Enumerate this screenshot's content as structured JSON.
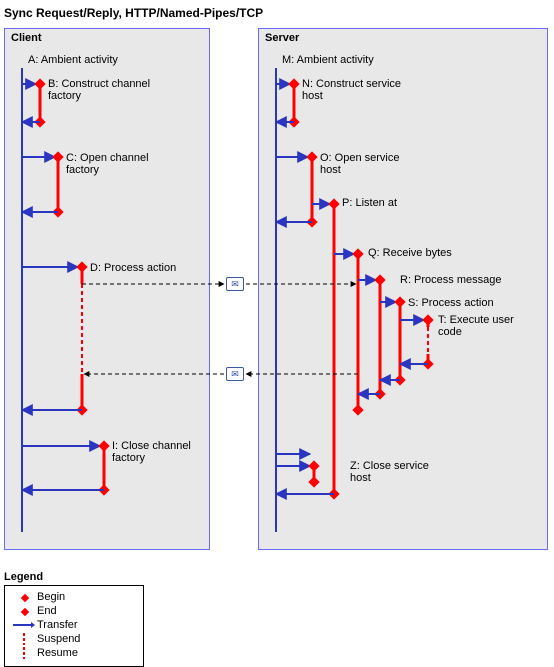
{
  "title": "Sync Request/Reply, HTTP/Named-Pipes/TCP",
  "client": {
    "title": "Client",
    "a": "A: Ambient activity",
    "b": "B: Construct channel factory",
    "c": "C: Open channel factory",
    "d": "D: Process action",
    "i": "I: Close channel factory"
  },
  "server": {
    "title": "Server",
    "m": "M: Ambient activity",
    "n": "N: Construct service host",
    "o": "O: Open service host",
    "p": "P: Listen at",
    "q": "Q: Receive bytes",
    "r": "R: Process message",
    "s": "S: Process action",
    "t": "T: Execute user code",
    "z": "Z: Close service host"
  },
  "legend": {
    "title": "Legend",
    "begin": "Begin",
    "end": "End",
    "transfer": "Transfer",
    "suspend": "Suspend",
    "resume": "Resume"
  },
  "colors": {
    "red": "#ff0000",
    "blue": "#2a36c0",
    "panelBorder": "#6a6aff",
    "panelBg": "#e8e8e8"
  },
  "chart_data": {
    "type": "table",
    "description": "Activity trace diagram for synchronous request/reply over HTTP, Named Pipes, or TCP",
    "lanes": [
      "Client",
      "Server"
    ],
    "client_activities": [
      {
        "id": "A",
        "label": "Ambient activity"
      },
      {
        "id": "B",
        "label": "Construct channel factory"
      },
      {
        "id": "C",
        "label": "Open channel factory"
      },
      {
        "id": "D",
        "label": "Process action"
      },
      {
        "id": "I",
        "label": "Close channel factory"
      }
    ],
    "server_activities": [
      {
        "id": "M",
        "label": "Ambient activity"
      },
      {
        "id": "N",
        "label": "Construct service host"
      },
      {
        "id": "O",
        "label": "Open service host"
      },
      {
        "id": "P",
        "label": "Listen at"
      },
      {
        "id": "Q",
        "label": "Receive bytes"
      },
      {
        "id": "R",
        "label": "Process message"
      },
      {
        "id": "S",
        "label": "Process action"
      },
      {
        "id": "T",
        "label": "Execute user code"
      },
      {
        "id": "Z",
        "label": "Close service host"
      }
    ],
    "messages": [
      {
        "from": "D",
        "to": "Q",
        "direction": "client-to-server"
      },
      {
        "from": "Q",
        "to": "D",
        "direction": "server-to-client"
      }
    ],
    "legend": [
      "Begin",
      "End",
      "Transfer",
      "Suspend",
      "Resume"
    ]
  }
}
